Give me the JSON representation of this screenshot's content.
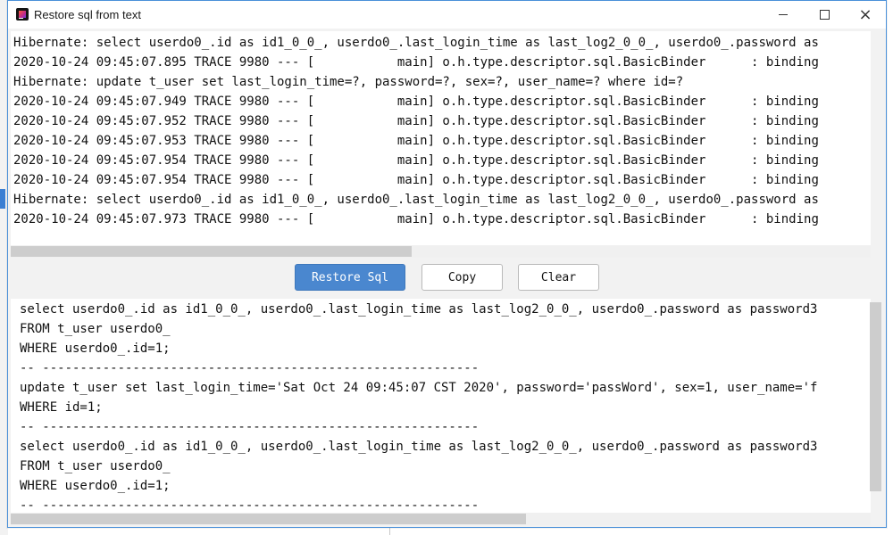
{
  "window": {
    "title": "Restore sql from text",
    "controls": {
      "minimize": "min-icon",
      "maximize": "max-icon",
      "close": "×"
    }
  },
  "log_text": [
    "Hibernate: select userdo0_.id as id1_0_0_, userdo0_.last_login_time as last_log2_0_0_, userdo0_.password as",
    "2020-10-24 09:45:07.895 TRACE 9980 --- [           main] o.h.type.descriptor.sql.BasicBinder      : binding",
    "Hibernate: update t_user set last_login_time=?, password=?, sex=?, user_name=? where id=?",
    "2020-10-24 09:45:07.949 TRACE 9980 --- [           main] o.h.type.descriptor.sql.BasicBinder      : binding",
    "2020-10-24 09:45:07.952 TRACE 9980 --- [           main] o.h.type.descriptor.sql.BasicBinder      : binding",
    "2020-10-24 09:45:07.953 TRACE 9980 --- [           main] o.h.type.descriptor.sql.BasicBinder      : binding",
    "2020-10-24 09:45:07.954 TRACE 9980 --- [           main] o.h.type.descriptor.sql.BasicBinder      : binding",
    "2020-10-24 09:45:07.954 TRACE 9980 --- [           main] o.h.type.descriptor.sql.BasicBinder      : binding",
    "Hibernate: select userdo0_.id as id1_0_0_, userdo0_.last_login_time as last_log2_0_0_, userdo0_.password as",
    "2020-10-24 09:45:07.973 TRACE 9980 --- [           main] o.h.type.descriptor.sql.BasicBinder      : binding"
  ],
  "buttons": {
    "restore": "Restore Sql",
    "copy": "Copy",
    "clear": "Clear"
  },
  "sql_output": [
    "select userdo0_.id as id1_0_0_, userdo0_.last_login_time as last_log2_0_0_, userdo0_.password as password3",
    "FROM t_user userdo0_",
    "WHERE userdo0_.id=1;",
    "-- ----------------------------------------------------------",
    "update t_user set last_login_time='Sat Oct 24 09:45:07 CST 2020', password='passWord', sex=1, user_name='f",
    "WHERE id=1;",
    "-- ----------------------------------------------------------",
    "select userdo0_.id as id1_0_0_, userdo0_.last_login_time as last_log2_0_0_, userdo0_.password as password3",
    "FROM t_user userdo0_",
    "WHERE userdo0_.id=1;",
    "-- ----------------------------------------------------------"
  ],
  "colors": {
    "accent": "#4a87cf",
    "window_border": "#4a90d9"
  }
}
